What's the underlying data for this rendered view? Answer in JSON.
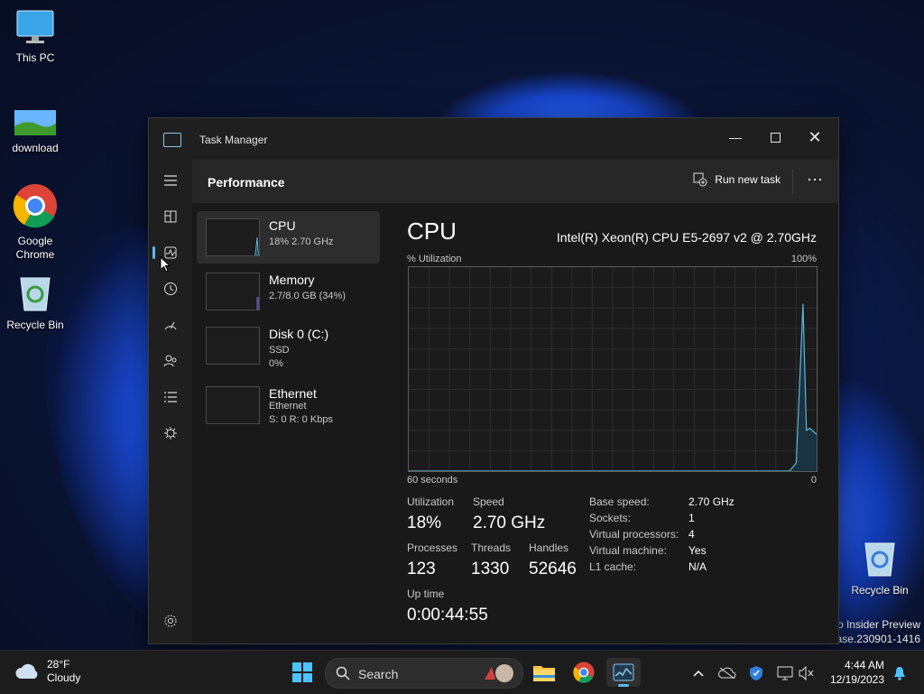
{
  "desktop": {
    "icons": [
      {
        "label": "This PC"
      },
      {
        "label": "download"
      },
      {
        "label": "Google Chrome"
      },
      {
        "label": "Recycle Bin"
      },
      {
        "label": "Recycle Bin"
      }
    ],
    "watermark_line1": "ro Insider Preview",
    "watermark_line2": "ease.230901-1416"
  },
  "window": {
    "title": "Task Manager",
    "header_title": "Performance",
    "run_task_label": "Run new task",
    "more_label": "⋯"
  },
  "sidebar": {
    "items": [
      {
        "icon": "hamburger-icon"
      },
      {
        "icon": "processes-icon"
      },
      {
        "icon": "performance-icon",
        "active": true
      },
      {
        "icon": "app-history-icon"
      },
      {
        "icon": "startup-apps-icon"
      },
      {
        "icon": "users-icon"
      },
      {
        "icon": "details-icon"
      },
      {
        "icon": "services-icon"
      },
      {
        "icon": "settings-icon"
      }
    ]
  },
  "resources": [
    {
      "name": "CPU",
      "line1": "18% 2.70 GHz",
      "line2": ""
    },
    {
      "name": "Memory",
      "line1": "2.7/8.0 GB (34%)",
      "line2": ""
    },
    {
      "name": "Disk 0 (C:)",
      "line1": "SSD",
      "line2": "0%"
    },
    {
      "name": "Ethernet",
      "line1": "Ethernet",
      "line2": "S: 0 R: 0 Kbps"
    }
  ],
  "detail": {
    "title": "CPU",
    "model": "Intel(R) Xeon(R) CPU E5-2697 v2 @ 2.70GHz",
    "util_label": "% Utilization",
    "max_label": "100%",
    "time_label": "60 seconds",
    "zero_label": "0",
    "stats": {
      "utilization_label": "Utilization",
      "utilization": "18%",
      "speed_label": "Speed",
      "speed": "2.70 GHz",
      "processes_label": "Processes",
      "processes": "123",
      "threads_label": "Threads",
      "threads": "1330",
      "handles_label": "Handles",
      "handles": "52646",
      "uptime_label": "Up time",
      "uptime": "0:00:44:55"
    },
    "specs": [
      {
        "k": "Base speed:",
        "v": "2.70 GHz"
      },
      {
        "k": "Sockets:",
        "v": "1"
      },
      {
        "k": "Virtual processors:",
        "v": "4"
      },
      {
        "k": "Virtual machine:",
        "v": "Yes"
      },
      {
        "k": "L1 cache:",
        "v": "N/A"
      }
    ]
  },
  "chart_data": {
    "type": "area",
    "title": "",
    "ylabel": "% Utilization",
    "xlabel": "60 seconds",
    "ylim": [
      0,
      100
    ],
    "x": [
      0,
      56,
      57,
      58,
      58.5,
      59,
      60
    ],
    "series": [
      {
        "values": [
          0,
          0,
          4,
          82,
          20,
          21,
          18
        ]
      }
    ]
  },
  "taskbar": {
    "temp": "28°F",
    "condition": "Cloudy",
    "search_placeholder": "Search",
    "time": "4:44 AM",
    "date": "12/19/2023"
  },
  "colors": {
    "accent": "#5eb8f0",
    "graph_line": "#5fb4d8",
    "graph_fill": "#1a3340"
  }
}
